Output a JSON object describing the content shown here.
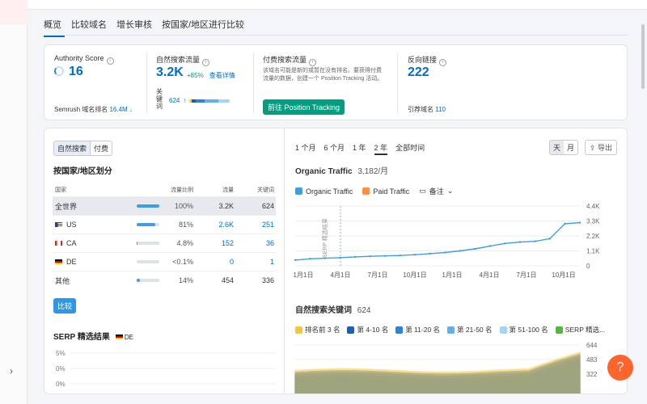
{
  "tabs": [
    "概览",
    "比较域名",
    "增长审核",
    "按国家/地区进行比较"
  ],
  "metrics": {
    "authority": {
      "title": "Authority Score",
      "value": "16",
      "rank_label": "Semrush 域名排名",
      "rank_value": "16.4M"
    },
    "organic": {
      "title": "自然搜索流量",
      "value": "3.2K",
      "change": "+85%",
      "details": "查看详情",
      "kw_label": "关键词",
      "kw_value": "624"
    },
    "paid": {
      "title": "付费搜索流量",
      "desc": "该域名可能是新的或暂在没有排名。要获得付费流量的数据，创建一个 Position Tracking 活动。",
      "button": "前往 Position Tracking"
    },
    "backlinks": {
      "title": "反向链接",
      "value": "222",
      "ref_label": "引荐域名",
      "ref_value": "110"
    }
  },
  "left": {
    "toggle": [
      "自然搜索",
      "付费"
    ],
    "country_title": "按国家/地区划分",
    "headers": [
      "国家",
      "流量比例",
      "流量",
      "关键词"
    ],
    "rows": [
      {
        "name": "全世界",
        "share": "100%",
        "fill": 1.0,
        "traffic": "3.2K",
        "kw": "624",
        "flag": ""
      },
      {
        "name": "US",
        "share": "81%",
        "fill": 0.81,
        "traffic": "2.6K",
        "kw": "251",
        "flag": "us"
      },
      {
        "name": "CA",
        "share": "4.8%",
        "fill": 0.048,
        "traffic": "152",
        "kw": "36",
        "flag": "ca"
      },
      {
        "name": "DE",
        "share": "<0.1%",
        "fill": 0.0,
        "traffic": "0",
        "kw": "1",
        "flag": "de"
      },
      {
        "name": "其他",
        "share": "14%",
        "fill": 0.14,
        "traffic": "454",
        "kw": "336",
        "flag": ""
      }
    ],
    "compare_button": "比较",
    "serp_title": "SERP 精选结果",
    "serp_country": "DE",
    "serp_ticks": [
      "5%",
      "0%",
      "0%"
    ]
  },
  "right": {
    "ranges": [
      "1 个月",
      "6 个月",
      "1 年",
      "2 年",
      "全部时间"
    ],
    "active_range": "2 年",
    "seg": [
      "天",
      "月"
    ],
    "export": "导出",
    "traffic_title": "Organic Traffic",
    "traffic_value": "3,182/月",
    "legend": [
      "Organic Traffic",
      "Paid Traffic",
      "备注"
    ],
    "serp_marker": "SERP 精选结果",
    "kw_title": "自然搜索关键词",
    "kw_value": "624",
    "kw_legend": [
      "排名前 3 名",
      "第 4-10 名",
      "第 11-20 名",
      "第 21-50 名",
      "第 51-100 名",
      "SERP 精选..."
    ],
    "kw_ticks": [
      "644",
      "483",
      "322"
    ],
    "colors": {
      "organic": "#3c9ee5",
      "paid": "#ff8f44",
      "top3": "#f5c542",
      "r4_10": "#1b5fb5",
      "r11_20": "#2a84d8",
      "r21_50": "#5fb0ec",
      "r51_100": "#a7d3f5",
      "serp": "#52b83a"
    }
  },
  "chart_data": {
    "type": "line",
    "title": "Organic Traffic",
    "x_ticks": [
      "1月1日",
      "4月1日",
      "7月1日",
      "10月1日",
      "1月1日",
      "4月1日",
      "7月1日",
      "10月1日"
    ],
    "ylim": [
      0,
      4400
    ],
    "y_ticks": [
      "4.4K",
      "3.3K",
      "2.2K",
      "1.1K",
      "0"
    ],
    "series": [
      {
        "name": "Organic Traffic",
        "values": [
          420,
          520,
          560,
          600,
          660,
          700,
          730,
          760,
          820,
          900,
          980,
          1100,
          1250,
          1450,
          1650,
          1750,
          1800,
          2000,
          3100,
          3182
        ]
      }
    ]
  }
}
